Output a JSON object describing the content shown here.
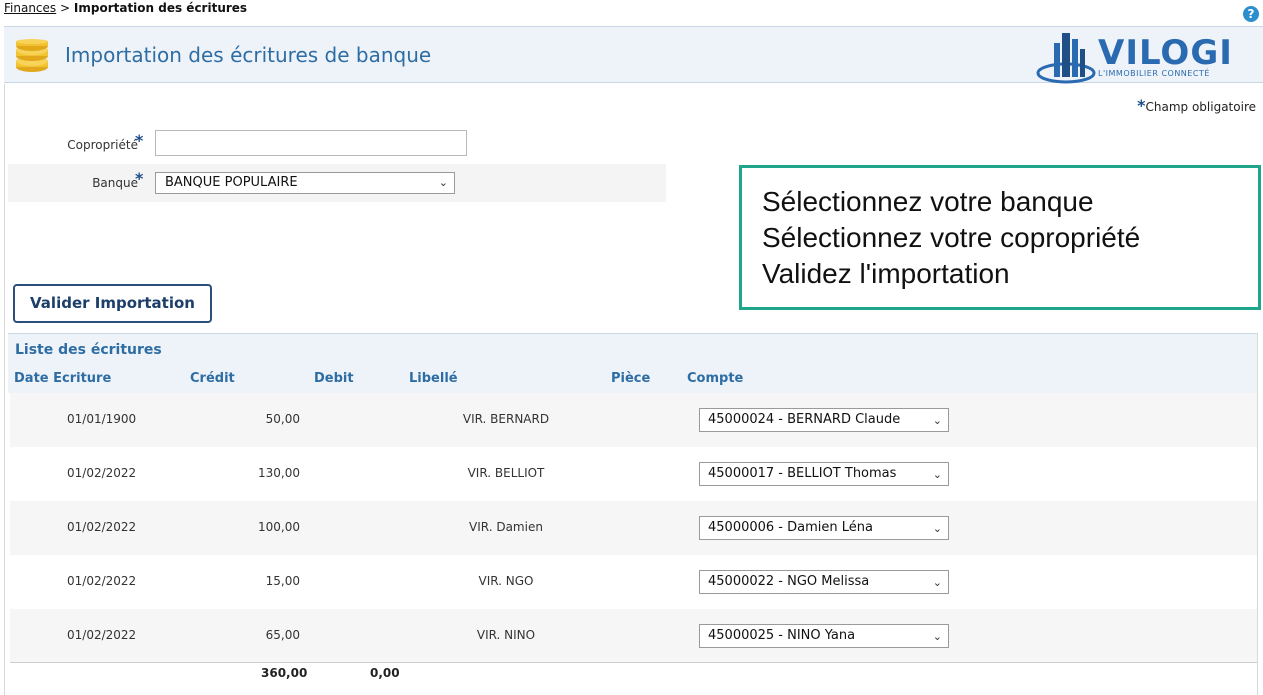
{
  "breadcrumb": {
    "root": "Finances",
    "separator": ">",
    "current": "Importation des écritures"
  },
  "header": {
    "title": "Importation des écritures de banque"
  },
  "logo": {
    "name": "VILOGI",
    "tagline": "L'IMMOBILIER CONNECTÉ"
  },
  "mandatory_note": {
    "star": "*",
    "text": "Champ obligatoire"
  },
  "form": {
    "copropriete_label": "Copropriété",
    "copropriete_value": "",
    "banque_label": "Banque",
    "banque_selected": "BANQUE POPULAIRE",
    "required_star": "*"
  },
  "callout": {
    "line1": "Sélectionnez votre banque",
    "line2": "Sélectionnez votre copropriété",
    "line3": "Validez l'importation"
  },
  "actions": {
    "valider_label": "Valider Importation"
  },
  "list": {
    "title": "Liste des écritures",
    "columns": [
      "Date Ecriture",
      "Crédit",
      "Debit",
      "Libellé",
      "Pièce",
      "Compte"
    ],
    "rows": [
      {
        "date": "01/01/1900",
        "credit": "50,00",
        "debit": "",
        "libelle": "VIR. BERNARD",
        "piece": "",
        "compte": "45000024 - BERNARD Claude"
      },
      {
        "date": "01/02/2022",
        "credit": "130,00",
        "debit": "",
        "libelle": "VIR. BELLIOT",
        "piece": "",
        "compte": "45000017 - BELLIOT Thomas"
      },
      {
        "date": "01/02/2022",
        "credit": "100,00",
        "debit": "",
        "libelle": "VIR. Damien",
        "piece": "",
        "compte": "45000006 - Damien Léna"
      },
      {
        "date": "01/02/2022",
        "credit": "15,00",
        "debit": "",
        "libelle": "VIR. NGO",
        "piece": "",
        "compte": "45000022 - NGO Melissa"
      },
      {
        "date": "01/02/2022",
        "credit": "65,00",
        "debit": "",
        "libelle": "VIR. NINO",
        "piece": "",
        "compte": "45000025 - NINO Yana"
      }
    ],
    "totals": {
      "credit": "360,00",
      "debit": "0,00"
    }
  },
  "icons": {
    "help": "help-icon",
    "coins": "coins-icon",
    "chevron": "chevron-down-icon"
  },
  "colors": {
    "accent": "#2e6da4",
    "callout_border": "#1fa58a",
    "header_bg": "#eef3f9"
  }
}
